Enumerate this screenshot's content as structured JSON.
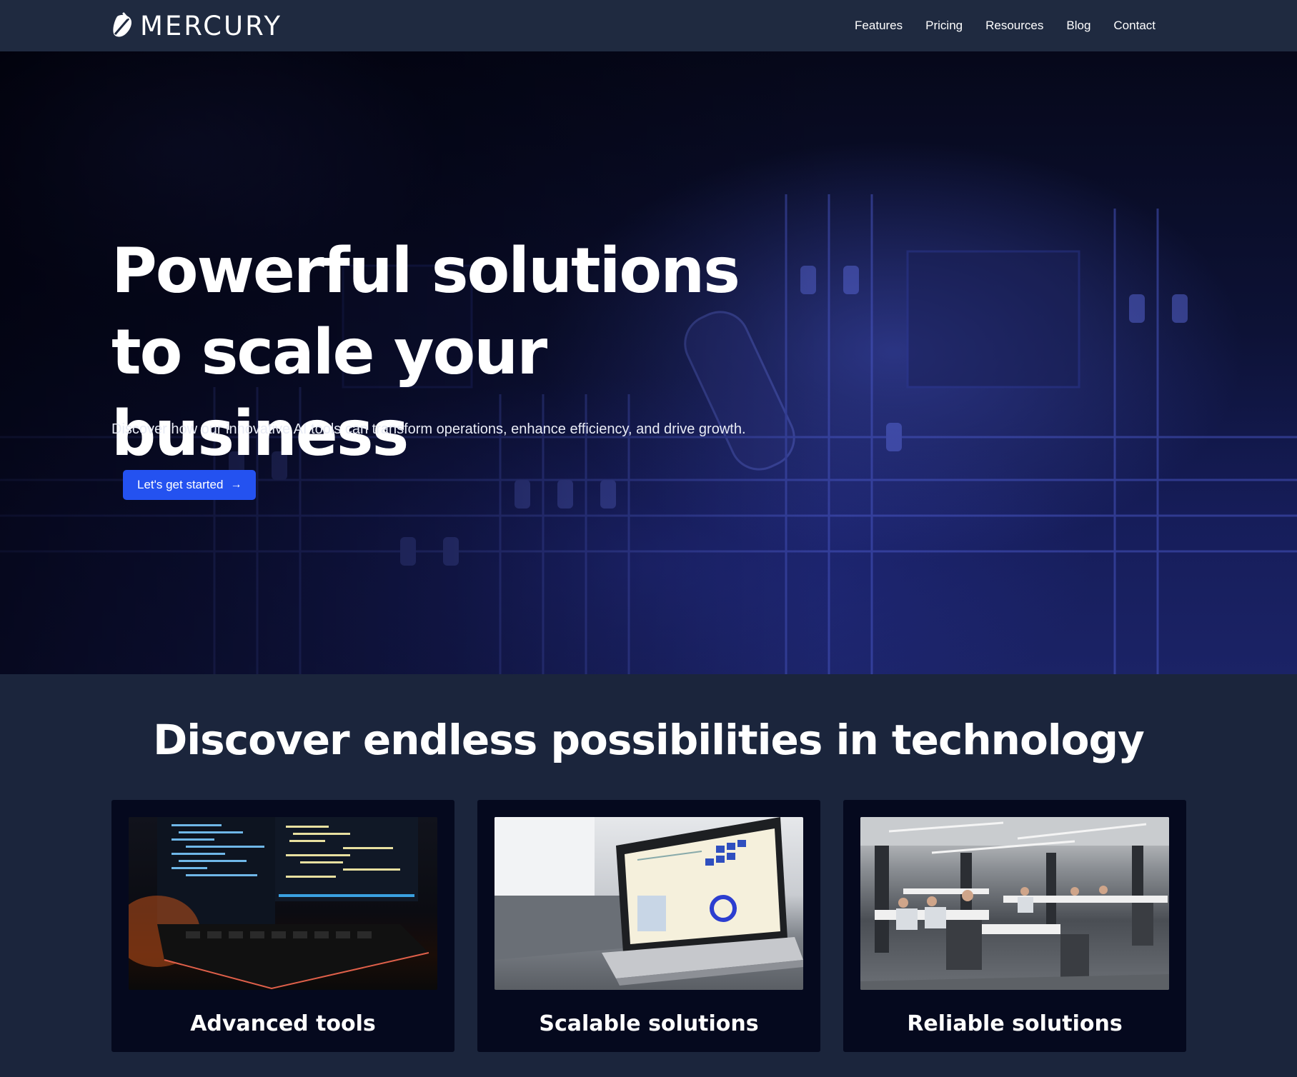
{
  "brand": {
    "name": "MERCURY"
  },
  "nav": {
    "items": [
      {
        "label": "Features"
      },
      {
        "label": "Pricing"
      },
      {
        "label": "Resources"
      },
      {
        "label": "Blog"
      },
      {
        "label": "Contact"
      }
    ]
  },
  "hero": {
    "title": "Powerful solutions to scale your business",
    "subtitle": "Discover how our innovative AI tools can transform operations, enhance efficiency, and drive growth.",
    "cta_label": "Let's get started",
    "cta_icon": "arrow-right-icon"
  },
  "features": {
    "title": "Discover endless possibilities in technology",
    "cards": [
      {
        "title": "Advanced tools",
        "image": "code-monitors-keyboard-image"
      },
      {
        "title": "Scalable solutions",
        "image": "laptop-dashboard-image"
      },
      {
        "title": "Reliable solutions",
        "image": "open-office-workers-image"
      }
    ]
  },
  "colors": {
    "nav_bg": "#1f2a40",
    "page_bg": "#1b253c",
    "card_bg": "#05091e",
    "accent": "#2452f0"
  }
}
